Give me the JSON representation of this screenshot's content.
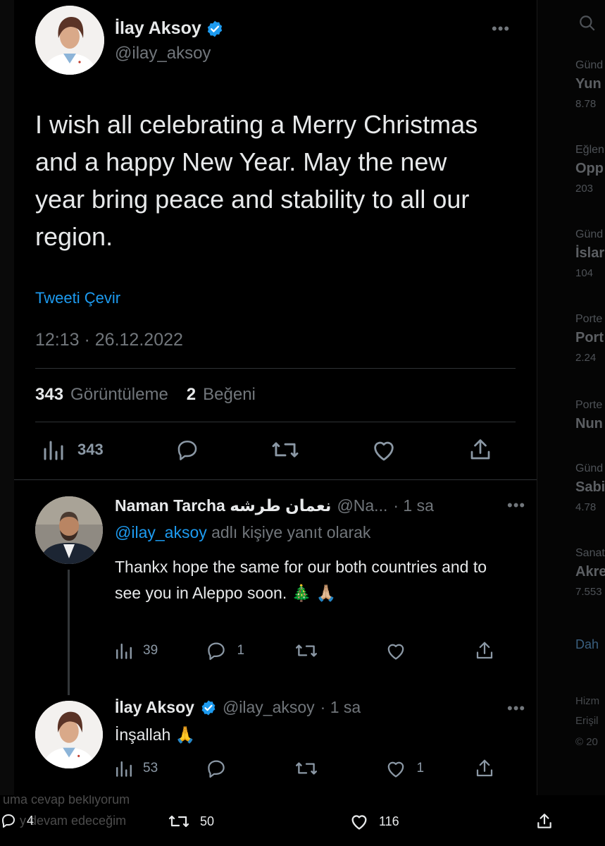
{
  "background": {
    "trends": [
      {
        "cat": "Günd",
        "name": "Yun",
        "count": "8.78"
      },
      {
        "cat": "Eğlen",
        "name": "Opp",
        "count": "203"
      },
      {
        "cat": "Günd",
        "name": "İslar",
        "count": "104"
      },
      {
        "cat": "Porte",
        "name": "Port",
        "count": "2.24"
      },
      {
        "cat": "Porte",
        "name": "Nun",
        "count": ""
      },
      {
        "cat": "Günd",
        "name": "Sabi",
        "count": "4.78"
      },
      {
        "cat": "Sanat",
        "name": "Akre",
        "count": "7.553"
      }
    ],
    "show_more": "Dah",
    "footer": [
      "Hizm",
      "Erişil",
      "© 20"
    ],
    "ghost_bottom": [
      "uma cevap bekliyorum",
      "y devam edeceğim"
    ]
  },
  "main_tweet": {
    "name": "İlay Aksoy",
    "handle": "@ilay_aksoy",
    "more": "•••",
    "text": "I wish all celebrating a Merry Christmas and a happy New Year. May the new year bring peace and stability to all our region.",
    "translate": "Tweeti Çevir",
    "timestamp": "12:13 · 26.12.2022",
    "views_count": "343",
    "views_label": "Görüntüleme",
    "likes_count": "2",
    "likes_label": "Beğeni",
    "analytics": "343"
  },
  "reply1": {
    "name": "Naman Tarcha نعمان طرشه",
    "handle": "@Na...",
    "time": "· 1 sa",
    "more": "•••",
    "reply_to_handle": "@ilay_aksoy",
    "reply_to_text": "adlı kişiye yanıt olarak",
    "text": "Thankx hope the same for our both countries and to see you in Aleppo soon. 🎄 🙏🏼",
    "views": "39",
    "replies": "1",
    "retweets": "",
    "likes": ""
  },
  "reply2": {
    "name": "İlay Aksoy",
    "handle": "@ilay_aksoy",
    "time": "· 1 sa",
    "more": "•••",
    "text": "İnşallah 🙏",
    "views": "53",
    "replies": "",
    "retweets": "",
    "likes": "1"
  },
  "bottom_bar": {
    "replies": "4",
    "retweets": "50",
    "likes": "116"
  },
  "colors": {
    "accent": "#1d9bf0",
    "verified": "#1d9bf0",
    "muted": "#71767b",
    "text": "#e7e9ea"
  }
}
